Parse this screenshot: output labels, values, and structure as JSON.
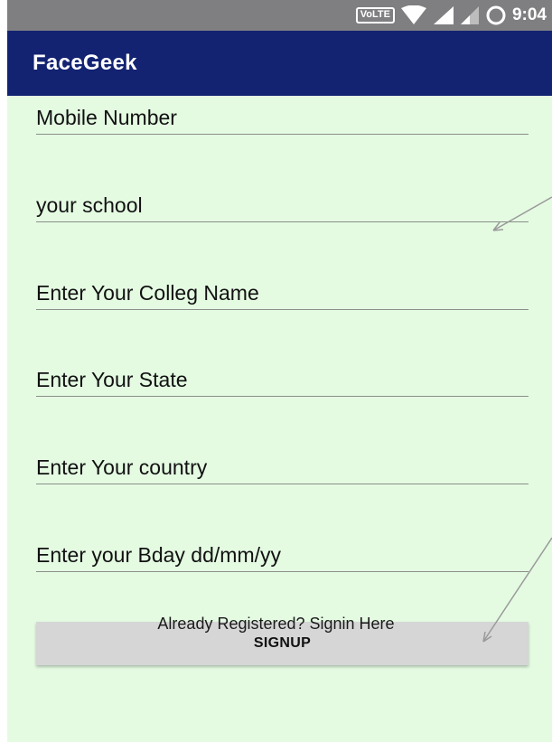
{
  "status_bar": {
    "network_badge": "VoLTE",
    "time": "9:04",
    "icons": [
      "wifi-icon",
      "signal-icon",
      "signal-icon",
      "circle-icon"
    ]
  },
  "app_bar": {
    "title": "FaceGeek"
  },
  "form": {
    "fields": [
      {
        "hint": "Mobile Number"
      },
      {
        "hint": "your school"
      },
      {
        "hint": "Enter Your Colleg Name"
      },
      {
        "hint": "Enter Your State"
      },
      {
        "hint": "Enter Your country"
      },
      {
        "hint": "Enter your Bday dd/mm/yy"
      }
    ],
    "signup_label": "SIGNUP",
    "signin_link": "Already Registered? Signin Here"
  },
  "colors": {
    "app_bar": "#132372",
    "background": "#e4fbe2",
    "button": "#d6d6d6"
  }
}
